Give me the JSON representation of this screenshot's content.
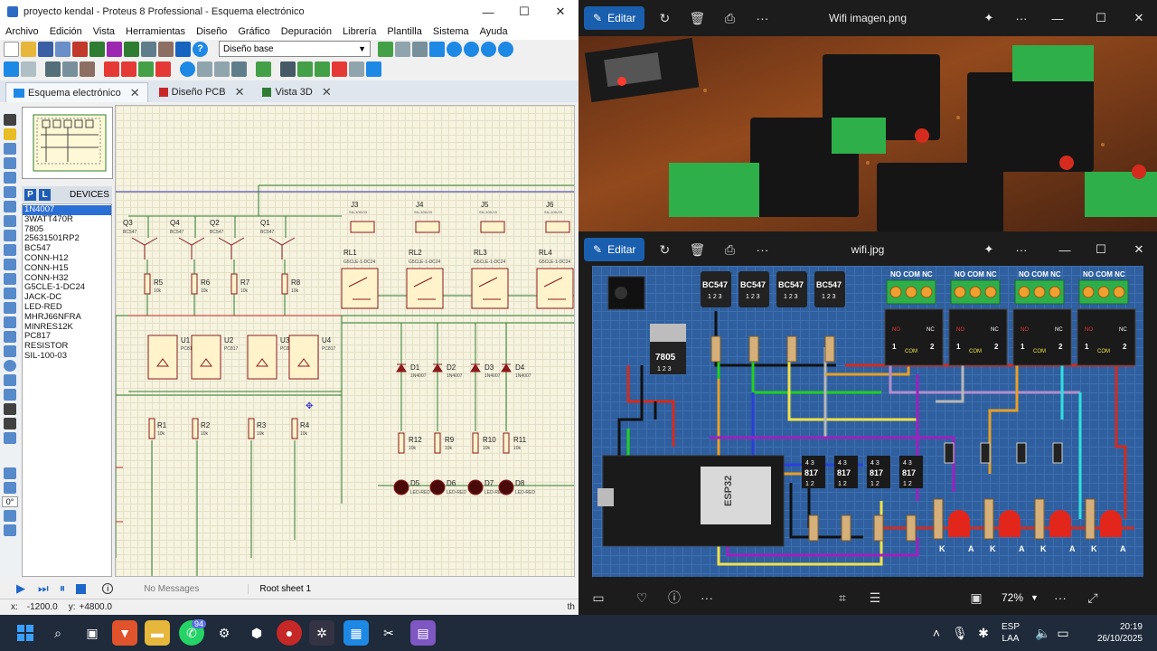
{
  "proteus": {
    "title": "proyecto kendal - Proteus 8 Professional - Esquema electrónico",
    "menu": [
      "Archivo",
      "Edición",
      "Vista",
      "Herramientas",
      "Diseño",
      "Gráfico",
      "Depuración",
      "Librería",
      "Plantilla",
      "Sistema",
      "Ayuda"
    ],
    "layer_select": "Diseño base",
    "tabs": [
      {
        "label": "Esquema electrónico",
        "icon": "schematic-icon"
      },
      {
        "label": "Diseño PCB",
        "icon": "pcb-icon"
      },
      {
        "label": "Vista 3D",
        "icon": "3d-icon"
      }
    ],
    "devices_title": "DEVICES",
    "devices_btn_p": "P",
    "devices_btn_l": "L",
    "devices": [
      "1N4007",
      "3WATT470R",
      "7805",
      "25631501RP2",
      "BC547",
      "CONN-H12",
      "CONN-H15",
      "CONN-H32",
      "G5CLE-1-DC24",
      "JACK-DC",
      "LED-RED",
      "MHRJ66NFRA",
      "MINRES12K",
      "PC817",
      "RESISTOR",
      "SIL-100-03"
    ],
    "selected_device": "1N4007",
    "rotation": "0°",
    "status_messages": "No Messages",
    "status_sheet": "Root sheet 1",
    "coord_x_label": "x:",
    "coord_x": "-1200.0",
    "coord_y_label": "y:",
    "coord_y": "+4800.0",
    "coord_unit": "th",
    "schematic": {
      "transistors": [
        "Q3",
        "Q4",
        "Q2",
        "Q1"
      ],
      "transistor_part": "BC547",
      "r_top": [
        "R5",
        "R6",
        "R7",
        "R8"
      ],
      "r_top_val": "10k",
      "connectors": [
        "J3",
        "J4",
        "J5",
        "J6"
      ],
      "connector_part": "SIL-100-03",
      "relays": [
        "RL1",
        "RL2",
        "RL3",
        "RL4"
      ],
      "relay_part": "G5CLE-1-DC24",
      "optos": [
        "U1",
        "U2",
        "U3",
        "U4"
      ],
      "opto_part": "PC817",
      "diodes": [
        "D1",
        "D2",
        "D3",
        "D4"
      ],
      "diode_part": "1N4007",
      "r_bottom": [
        "R1",
        "R2",
        "R3",
        "R4"
      ],
      "r_bottom_val": "10k",
      "r_led": [
        "R12",
        "R9",
        "R10",
        "R11"
      ],
      "r_led_val": "10k",
      "leds": [
        "D5",
        "D6",
        "D7",
        "D8"
      ],
      "led_part": "LED-RED"
    }
  },
  "photo1": {
    "edit_label": "Editar",
    "title": "Wifi imagen.png"
  },
  "photo2": {
    "edit_label": "Editar",
    "title": "wifi.jpg",
    "zoom": "72%",
    "diagram": {
      "transistors": [
        "BC547",
        "BC547",
        "BC547",
        "BC547"
      ],
      "pin_labels": "1 2 3",
      "regulator": "7805",
      "regulator_pins": "1 2 3",
      "relay_header": "NO COM NC",
      "relay_pin1": "1",
      "relay_pin2": "2",
      "relay_com": "COM",
      "relay_nc": "NC",
      "relay_no": "NO",
      "optos": [
        "817",
        "817",
        "817",
        "817"
      ],
      "opto_top": "4 3",
      "opto_bottom": "1 2",
      "mcu": "ESP32",
      "led_k": "K",
      "led_a": "A"
    }
  },
  "taskbar": {
    "lang_top": "ESP",
    "lang_bottom": "LAA",
    "time": "20:19",
    "date": "26/10/2025",
    "whatsapp_badge": "94"
  }
}
